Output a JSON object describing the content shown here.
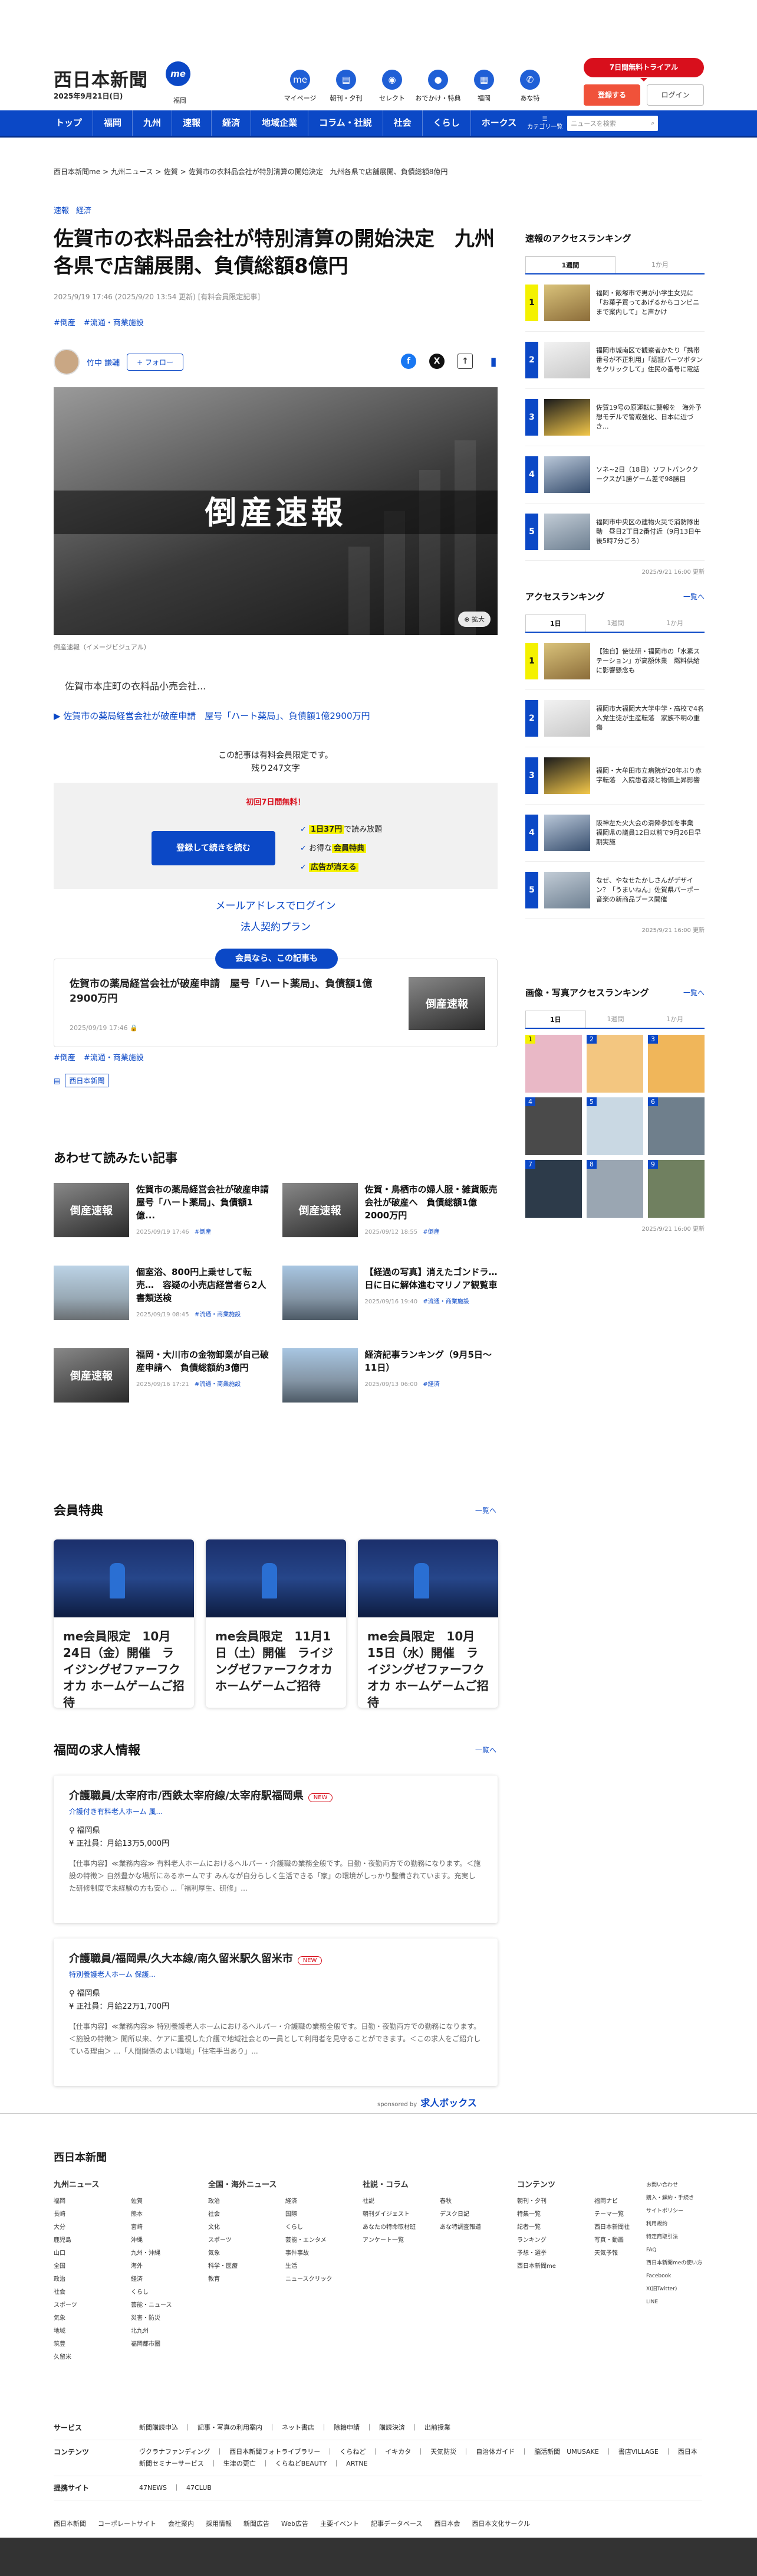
{
  "header": {
    "logo": "西日本新聞",
    "logo_me": "me",
    "date": "2025年9月21日(日)",
    "region": "福岡",
    "icons": [
      {
        "label": "マイページ",
        "icon": "me-icon",
        "color": "#1f5fd6"
      },
      {
        "label": "朝刊・夕刊",
        "icon": "newspaper-icon",
        "color": "#1f5fd6"
      },
      {
        "label": "セレクト",
        "icon": "select-icon",
        "color": "#1f5fd6"
      },
      {
        "label": "おでかけ・特典",
        "icon": "footprints-icon",
        "color": "#1f5fd6"
      },
      {
        "label": "福岡",
        "icon": "building-icon",
        "color": "#1f5fd6"
      },
      {
        "label": "あな特",
        "icon": "megaphone-icon",
        "color": "#1f5fd6"
      }
    ],
    "trial": "7日間無料トライアル",
    "register": "登録する",
    "login": "ログイン"
  },
  "nav": {
    "items": [
      "トップ",
      "福岡",
      "九州",
      "速報",
      "経済",
      "地域企業",
      "コラム・社説",
      "社会",
      "くらし",
      "ホークス"
    ],
    "category": "カテゴリ一覧",
    "search_placeholder": "ニュースを検索"
  },
  "breadcrumb": [
    "西日本新聞me",
    "九州ニュース",
    "佐賀",
    "佐賀市の衣料品会社が特別清算の開始決定　九州各県で店舗展開、負債総額8億円"
  ],
  "article": {
    "tags": [
      "速報",
      "経済"
    ],
    "title": "佐賀市の衣料品会社が特別清算の開始決定　九州各県で店舗展開、負債総額8億円",
    "date": "2025/9/19 17:46 (2025/9/20 13:54 更新)",
    "paid_badge": "[有料会員限定記事]",
    "keywords": [
      "#倒産",
      "#流通・商業施設"
    ],
    "author": "竹中 謙輔",
    "follow": "+ フォロー",
    "hero_text": "倒産速報",
    "zoom": "拡大",
    "caption": "倒産速報（イメージビジュアル）",
    "lead": "佐賀市本庄町の衣料品小売会社...",
    "related": "▶ 佐賀市の薬局経営会社が破産申請　屋号「ハート薬局」、負債額1億2900万円",
    "paynote1": "この記事は有料会員限定です。",
    "paynote2": "残り247文字",
    "free": "初回7日間無料！",
    "register_btn": "登録して続きを読む",
    "perk1a": "1日37円",
    "perk1b": "で読み放題",
    "perk2a": "お得な",
    "perk2b": "会員特典",
    "perk3": "広告が消える",
    "mail_login": "メールアドレスでログイン",
    "corp_plan": "法人契約プラン",
    "member_pill": "会員なら、この記事も",
    "member_title": "佐賀市の薬局経営会社が破産申請　屋号「ハート薬局」、負債額1億2900万円",
    "member_date": "2025/09/19 17:46",
    "source": "西日本新聞"
  },
  "also_read": {
    "heading": "あわせて読みたい記事",
    "items": [
      {
        "title": "佐賀市の薬局経営会社が破産申請　屋号「ハート薬局」、負債額1億...",
        "date": "2025/09/19 17:46",
        "tag": "#倒産",
        "img": "dark"
      },
      {
        "title": "佐賀・鳥栖市の婦人服・雑貨販売会社が破産へ　負債総額1億2000万円",
        "date": "2025/09/12 18:55",
        "tag": "#倒産",
        "img": "dark"
      },
      {
        "title": "個室浴、800円上乗せして転売…　容疑の小売店経営者ら2人書類送検",
        "date": "2025/09/19 08:45",
        "tag": "#流通・商業施設",
        "img": "street"
      },
      {
        "title": "【経過の写真】消えたゴンドラ…日に日に解体進むマリノア観覧車",
        "date": "2025/09/16 19:40",
        "tag": "#流通・商業施設",
        "img": "city"
      },
      {
        "title": "福岡・大川市の金物卸業が自己破産申請へ　負債総額約3億円",
        "date": "2025/09/16 17:21",
        "tag": "#流通・商業施設",
        "img": "dark"
      },
      {
        "title": "経済記事ランキング（9月5日〜11日）",
        "date": "2025/09/13 06:00",
        "tag": "#経済",
        "img": "city"
      }
    ]
  },
  "benefits": {
    "heading": "会員特典",
    "more": "一覧へ",
    "items": [
      "me会員限定　10月24日（金）開催　ライジングゼファーフクオカ ホームゲームご招待",
      "me会員限定　11月1日（土）開催　ライジングゼファーフクオカ ホームゲームご招待",
      "me会員限定　10月15日（水）開催　ライジングゼファーフクオカ ホームゲームご招待"
    ]
  },
  "jobs": {
    "heading": "福岡の求人情報",
    "more": "一覧へ",
    "items": [
      {
        "title": "介護職員/太宰府市/西鉄太宰府線/太宰府駅福岡県",
        "new": "NEW",
        "company": "介護付き有料老人ホーム 風...",
        "place": "福岡県",
        "salary": "正社員：月給13万5,000円",
        "desc": "【仕事内容】≪業務内容≫ 有料老人ホームにおけるヘルパー・介護職の業務全般です。日勤・夜勤両方での勤務になります。＜施設の特徴＞ 自然豊かな場所にあるホームです みんなが自分らしく生活できる「家」の環境がしっかり整備されています。充実した研修制度で未経験の方も安心 ...「福利厚生、研修」..."
      },
      {
        "title": "介護職員/福岡県/久大本線/南久留米駅久留米市",
        "new": "NEW",
        "company": "特別養護老人ホーム 保護...",
        "place": "福岡県",
        "salary": "正社員：月給22万1,700円",
        "desc": "【仕事内容】≪業務内容≫ 特別養護老人ホームにおけるヘルパー・介護職の業務全般です。日勤・夜勤両方での勤務になります。＜施設の特徴＞ 開所以来、ケアに重視した介護で地域社会との一員として利用者を見守ることができます。＜この求人をご紹介している理由＞ ...「人間関係のよい職場」「住宅手当あり」..."
      }
    ],
    "sponsor": "sponsored by",
    "sponsor_brand": "求人ボックス"
  },
  "sidebar": {
    "access_weekly": {
      "heading": "速報のアクセスランキング",
      "tabs": [
        "1週間",
        "1か月"
      ],
      "items": [
        "福岡・飯塚市で男が小学生女児に「お菓子買ってあげるからコンビニまで案内して」と声かけ",
        "福岡市城南区で観察者かたり「携帯番号が不正利用」「認証パーツボタンをクリックして」住民の番号に電話",
        "佐賀19号の原運転に警報を　海外予想モデルで警戒強化、日本に近づき...",
        "ソネ~2日（18日）ソフトバンククークスが1勝ゲーム差で98勝目",
        "福岡市中央区の建物火災で消防隊出動　昼日2丁目2番付近（9月13日午後5時7分ごろ）"
      ],
      "updated": "2025/9/21 16:00 更新"
    },
    "access": {
      "heading": "アクセスランキング",
      "more": "一覧へ",
      "tabs": [
        "1日",
        "1週間",
        "1か月"
      ],
      "items": [
        "【独自】使徒研・福岡市の「水素ステーション」が高額休業　燃料供給に影響懸念も",
        "福岡市大福岡大大学中学・高校で4名入党生徒が生産転落　家族不明の重傷",
        "福岡・大牟田市立病院が20年ぶり赤字転落　入院患者減と物価上昇影響",
        "阪神左た火大会の滑降参加を事業　福岡県の議員12日以前で9月26日早期実施",
        "なぜ、やなせたかしさんがデザイン？「うまいねん」佐賀県パーポー音楽の新商品ブース開催"
      ],
      "updated": "2025/9/21 16:00 更新"
    },
    "photo": {
      "heading": "画像・写真アクセスランキング",
      "more": "一覧へ",
      "tabs": [
        "1日",
        "1週間",
        "1か月"
      ],
      "updated": "2025/9/21 16:00 更新"
    }
  },
  "footer": {
    "logo": "西日本新聞",
    "cols": [
      {
        "h": "九州ニュース",
        "items": [
          "福岡",
          "佐賀",
          "長崎",
          "熊本",
          "大分",
          "宮崎",
          "鹿児島",
          "沖縄",
          "山口",
          "九州・沖縄",
          "全国",
          "海外",
          "政治",
          "経済",
          "社会",
          "くらし",
          "スポーツ",
          "芸能・ニュース",
          "気象",
          "災害・防災",
          "地域",
          "北九州",
          "筑豊",
          "福岡都市圏",
          "久留米"
        ]
      },
      {
        "h": "全国・海外ニュース",
        "items": [
          "政治",
          "経済",
          "社会",
          "国際",
          "文化",
          "くらし",
          "スポーツ",
          "芸能・エンタメ",
          "気象",
          "事件事故",
          "科学・医療",
          "生活",
          "教育",
          "ニュースクリック"
        ]
      },
      {
        "h": "社説・コラム",
        "items": [
          "社説",
          "春秋",
          "朝刊ダイジェスト",
          "デスク日記",
          "あなたの特命取材班",
          "あな特調査報道",
          "アンケート一覧"
        ]
      },
      {
        "h": "コンテンツ",
        "items": [
          "朝刊・夕刊",
          "福岡ナビ",
          "特集一覧",
          "テーマ一覧",
          "記者一覧",
          "西日本新聞社",
          "ランキング",
          "写真・動画",
          "予想・選挙",
          "天気予報",
          "西日本新聞me"
        ]
      }
    ],
    "small": [
      "お問い合わせ",
      "購入・解約・手続き",
      "サイトポリシー",
      "利用規約",
      "特定商取引法",
      "FAQ",
      "西日本新聞meの使い方",
      "Facebook",
      "X(旧Twitter)",
      "LINE"
    ],
    "rows": [
      {
        "h": "サービス",
        "v": "新聞購読申込　｜　記事・写真の利用案内　｜　ネット書店　｜　除籍申請　｜　購読決済　｜　出前授業"
      },
      {
        "h": "コンテンツ",
        "v": "ヴクラナファンディング　｜　西日本新聞フォトライブラリー　｜　くらねど　｜　イキカタ　｜　天気防災　｜　自治体ガイド　｜　脳活新聞　UMUSAKE　｜　書店VILLAGE　｜　西日本新聞セミナーサービス　｜　生津の更亡　｜　くらねどBEAUTY　｜　ARTNE"
      },
      {
        "h": "提携サイト",
        "v": "47NEWS　｜　47CLUB"
      }
    ],
    "bottom": [
      "西日本新聞",
      "コーポレートサイト",
      "会社案内",
      "採用情報",
      "新聞広告",
      "Web広告",
      "主要イベント",
      "記事データベース",
      "西日本会",
      "西日本文化サークル"
    ]
  }
}
